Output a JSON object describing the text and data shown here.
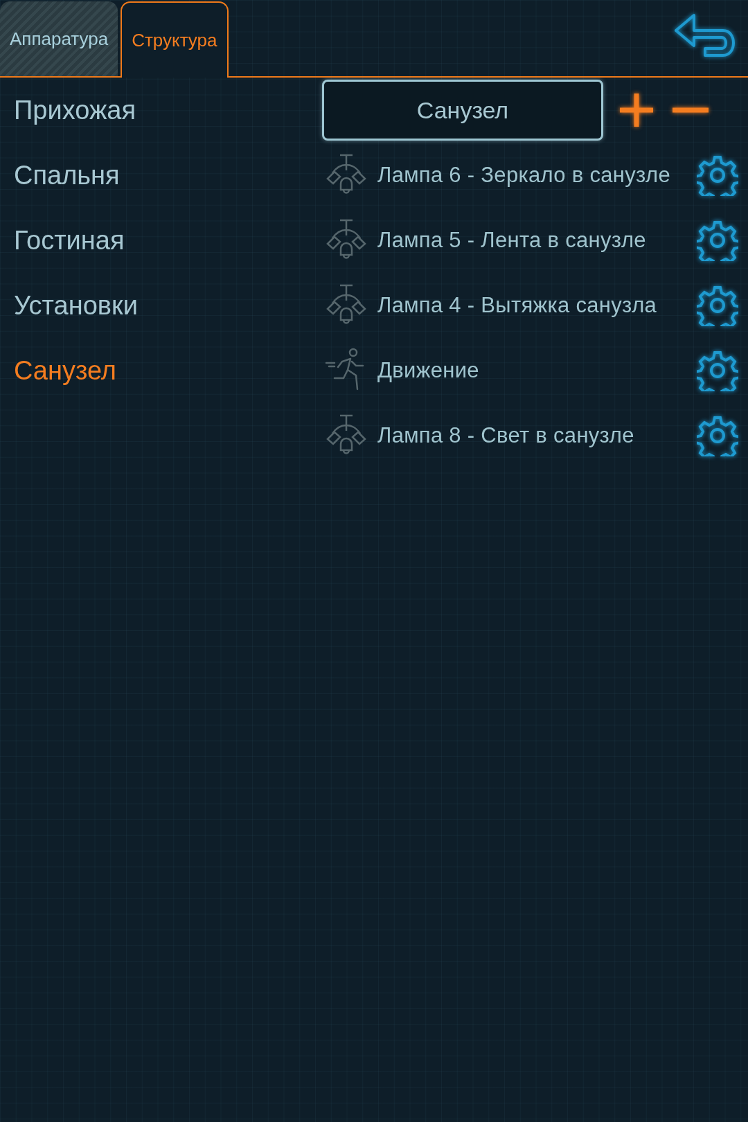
{
  "tabs": [
    {
      "label": "Аппаратура",
      "selected": false
    },
    {
      "label": "Структура",
      "selected": true
    }
  ],
  "rooms": [
    {
      "name": "Прихожая",
      "selected": false
    },
    {
      "name": "Спальня",
      "selected": false
    },
    {
      "name": "Гостиная",
      "selected": false
    },
    {
      "name": "Установки",
      "selected": false
    },
    {
      "name": "Санузел",
      "selected": true
    }
  ],
  "room_name": {
    "value": "Санузел"
  },
  "devices": [
    {
      "kind": "lamp",
      "name": "Лампа 6 - Зеркало в санузле"
    },
    {
      "kind": "lamp",
      "name": "Лампа 5 - Лента в санузле"
    },
    {
      "kind": "lamp",
      "name": "Лампа 4 - Вытяжка санузла"
    },
    {
      "kind": "motion",
      "name": "Движение"
    },
    {
      "kind": "lamp",
      "name": "Лампа 8 - Свет в санузле"
    }
  ]
}
